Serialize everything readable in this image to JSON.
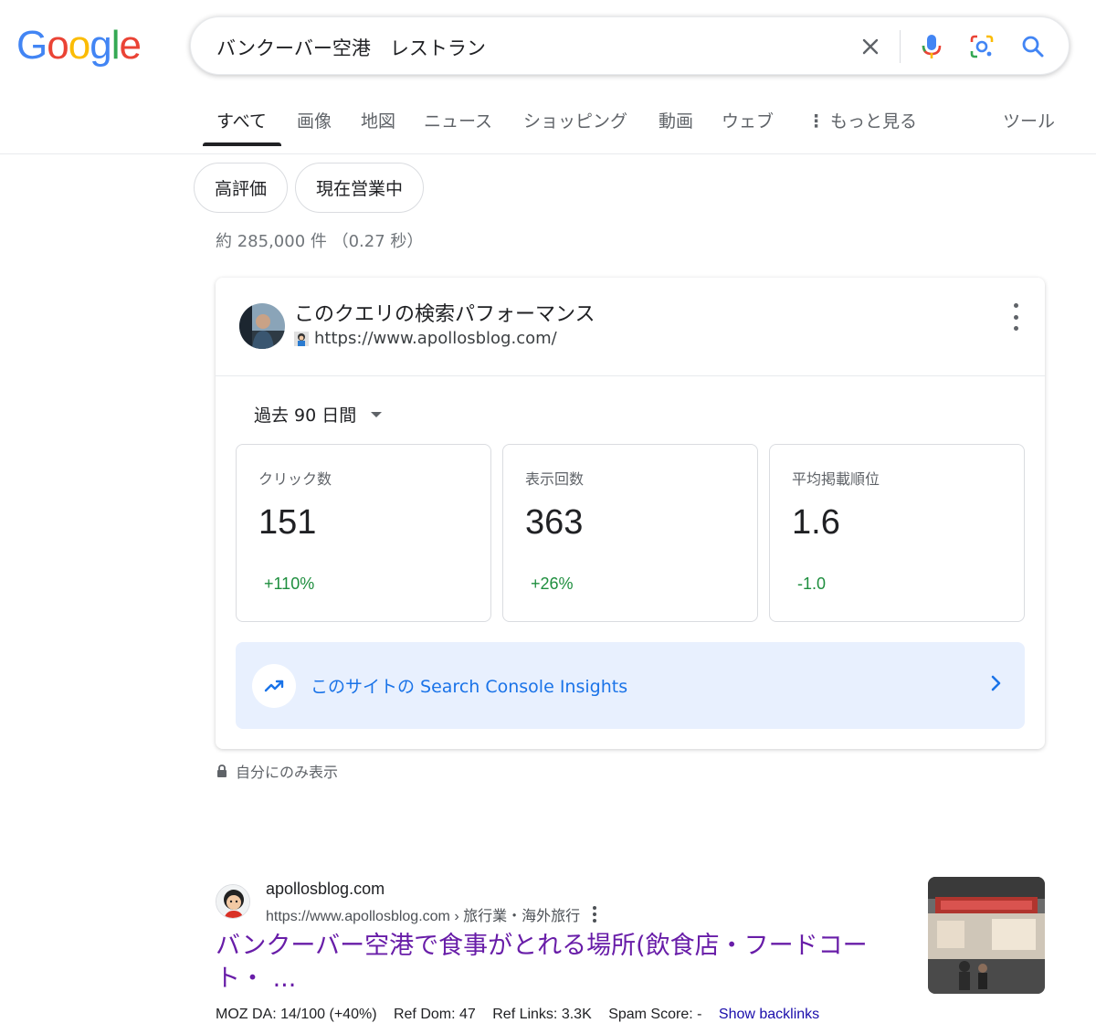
{
  "logo": {
    "letters": [
      "G",
      "o",
      "o",
      "g",
      "l",
      "e"
    ],
    "colors": [
      "#4285F4",
      "#EA4335",
      "#FBBC05",
      "#4285F4",
      "#34A853",
      "#EA4335"
    ]
  },
  "search": {
    "query": "バンクーバー空港　レストラン"
  },
  "tabs": [
    {
      "label": "すべて"
    },
    {
      "label": "画像"
    },
    {
      "label": "地図"
    },
    {
      "label": "ニュース"
    },
    {
      "label": "ショッピング"
    },
    {
      "label": "動画"
    },
    {
      "label": "ウェブ"
    },
    {
      "label": "もっと見る"
    }
  ],
  "tools_label": "ツール",
  "chips": [
    {
      "label": "高評価"
    },
    {
      "label": "現在営業中"
    }
  ],
  "result_stats": "約 285,000 件 （0.27 秒）",
  "search_console": {
    "title": "このクエリの検索パフォーマンス",
    "url": "https://www.apollosblog.com/",
    "period": "過去 90 日間",
    "metrics": [
      {
        "label": "クリック数",
        "value": "151",
        "delta": "+110%"
      },
      {
        "label": "表示回数",
        "value": "363",
        "delta": "+26%"
      },
      {
        "label": "平均掲載順位",
        "value": "1.6",
        "delta": "-1.0"
      }
    ],
    "insights_label": "このサイトの Search Console Insights",
    "private_note": "自分にのみ表示"
  },
  "result": {
    "site_name": "apollosblog.com",
    "breadcrumb": "https://www.apollosblog.com › 旅行業・海外旅行",
    "title": "バンクーバー空港で食事がとれる場所(飲食店・フードコート・ ...",
    "seo": {
      "moz_da": "MOZ DA: 14/100 (+40%)",
      "ref_dom": "Ref Dom: 47",
      "ref_links": "Ref Links: 3.3K",
      "spam": "Spam Score: -",
      "backlinks": "Show backlinks"
    }
  },
  "accent": {
    "blue": "#1a73e8",
    "green": "#1e8e3e",
    "visited": "#681da8"
  }
}
